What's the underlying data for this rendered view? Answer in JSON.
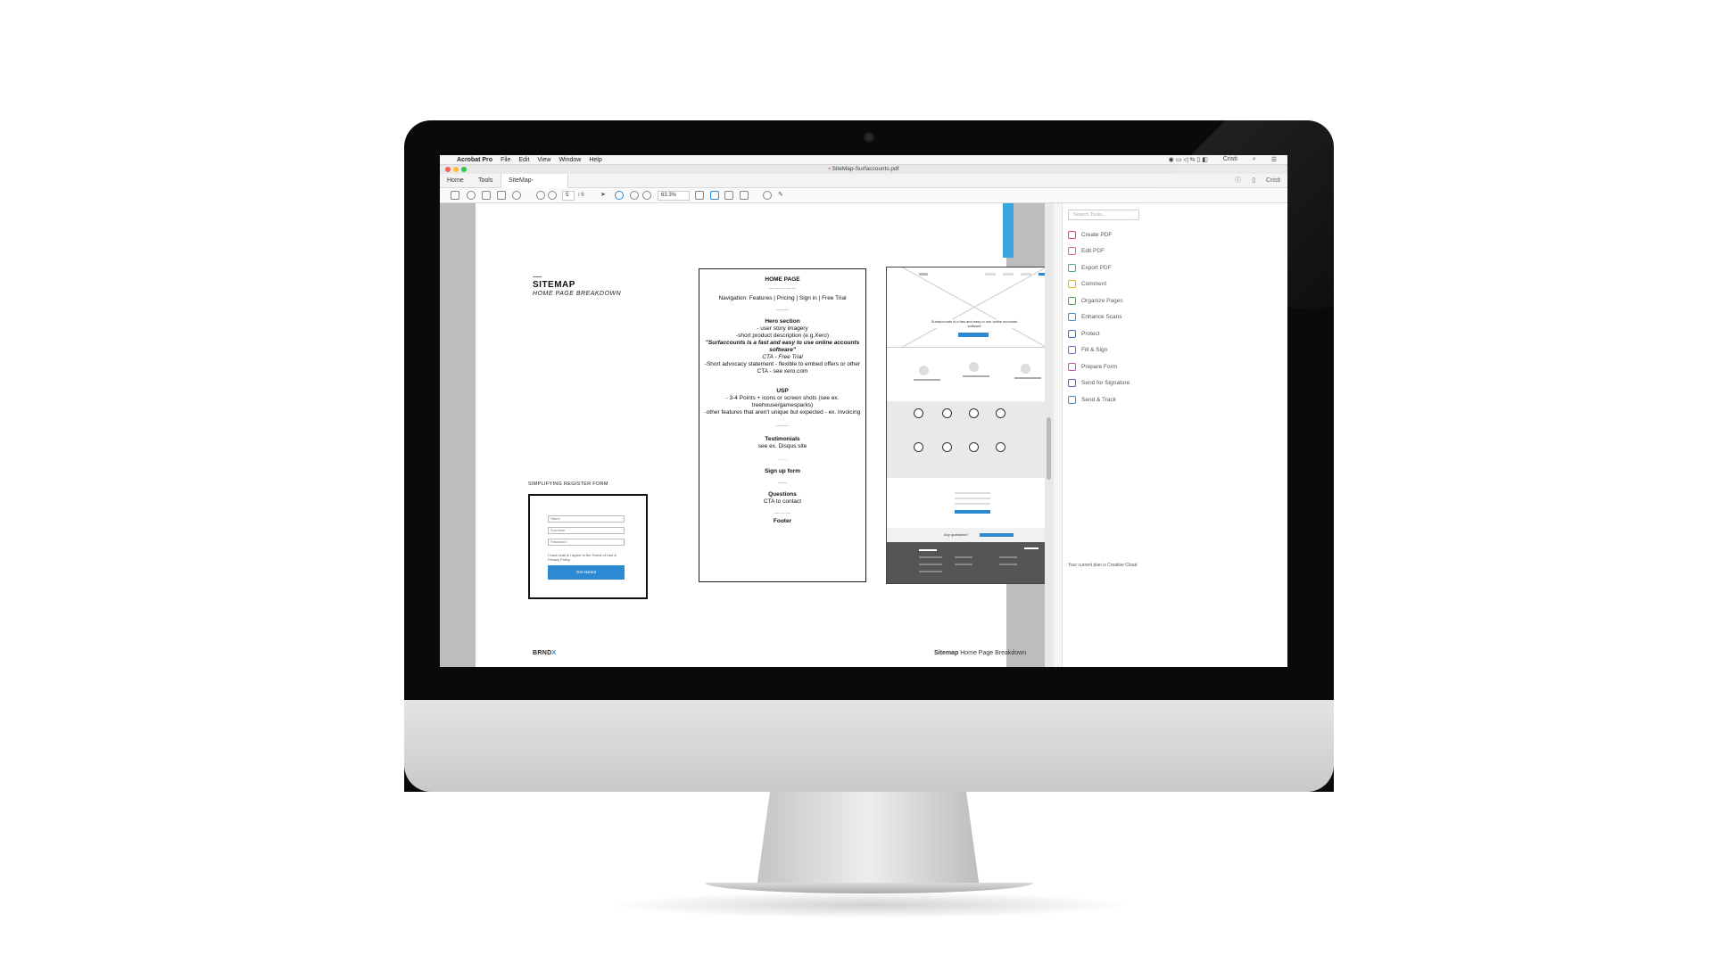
{
  "menubar": {
    "apple": "",
    "app_name": "Acrobat Pro",
    "items": [
      "File",
      "Edit",
      "View",
      "Window",
      "Help"
    ],
    "user": "Cristi"
  },
  "window": {
    "title": "SiteMap-Surfaccounts.pdf"
  },
  "tabs": {
    "home": "Home",
    "tools": "Tools",
    "document": "SiteMap-Surfacco...",
    "close": "×",
    "user": "Cristi"
  },
  "toolbar": {
    "page_current": "5",
    "page_total": "/ 6",
    "zoom": "63.3%"
  },
  "document": {
    "sitemap_title": "SITEMAP",
    "sitemap_subtitle": "HOME PAGE BREAKDOWN",
    "register_label": "SIMPLIFYING REGISTER FORM",
    "register_fields": [
      "Name",
      "Surname",
      "Password"
    ],
    "register_terms": "I have read & I agree to the Terms of Use & Privacy Policy",
    "register_button": "Get started",
    "homepage": {
      "title": "HOME PAGE",
      "navigation": "Navigation: Features | Pricing | Sign in | Free Trial",
      "hero_heading": "Hero section",
      "hero_line1": "- user story imagery",
      "hero_line2": "-short product description (e.g.Xero)",
      "hero_quote": "\"Surfaccounts is a fast and easy to use online accounts software\"",
      "hero_cta": "CTA - Free Trial",
      "hero_line3": "-Short advocacy statement - flexible to embed offers or other CTA - see xero.com",
      "usp_heading": "USP",
      "usp_line1": "- 3-4 Points + icons or screen shots (see ex. treehouse/gamesparks)",
      "usp_line2": "-other features that aren't unique but expected - ex. invoicing",
      "testimonials_heading": "Testimonials",
      "testimonials_line": "see ex. Disqus site",
      "signup_heading": "Sign up form",
      "questions_heading": "Questions",
      "questions_line": "CTA to contact",
      "footer_heading": "Footer"
    },
    "wireframe": {
      "hero_text": "Surfaccounts is a fast and easy to use online accounts software",
      "questions": "Any questions?"
    },
    "footer_logo_a": "BRND",
    "footer_logo_b": "X",
    "footer_section": "Sitemap",
    "footer_title": "Home Page Breakdown"
  },
  "tools_pane": {
    "search_placeholder": "Search Tools...",
    "tools": [
      {
        "label": "Create PDF",
        "color": "#e0474c"
      },
      {
        "label": "Edit PDF",
        "color": "#e85fa1"
      },
      {
        "label": "Export PDF",
        "color": "#3fb37a"
      },
      {
        "label": "Comment",
        "color": "#f2b01e"
      },
      {
        "label": "Organize Pages",
        "color": "#4fa84e"
      },
      {
        "label": "Enhance Scans",
        "color": "#3a8fd0"
      },
      {
        "label": "Protect",
        "color": "#3a6fd0"
      },
      {
        "label": "Fill & Sign",
        "color": "#8c5ad6"
      },
      {
        "label": "Prepare Form",
        "color": "#d24aa8"
      },
      {
        "label": "Send for Signature",
        "color": "#5560c9"
      },
      {
        "label": "Send & Track",
        "color": "#3a8fd0"
      }
    ],
    "plan_text": "Your current plan is Creative Cloud"
  }
}
